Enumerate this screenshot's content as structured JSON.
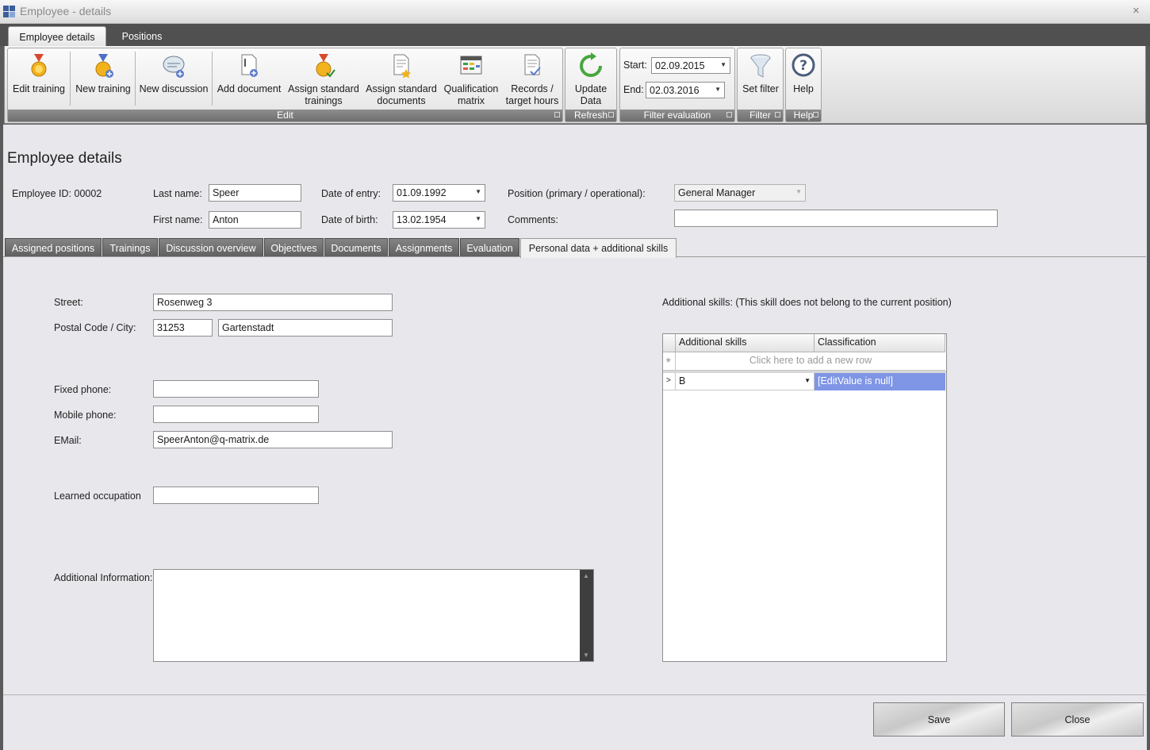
{
  "window": {
    "title": "Employee - details",
    "close_glyph": "×"
  },
  "ribbon": {
    "tabs": [
      {
        "label": "Employee details"
      },
      {
        "label": "Positions"
      }
    ],
    "groups": {
      "edit": {
        "caption": "Edit",
        "buttons": {
          "edit_training": "Edit training",
          "new_training": "New training",
          "new_discussion": "New discussion",
          "add_document": "Add document",
          "assign_std_trainings_1": "Assign standard",
          "assign_std_trainings_2": "trainings",
          "assign_std_documents_1": "Assign standard",
          "assign_std_documents_2": "documents",
          "qual_matrix_1": "Qualification",
          "qual_matrix_2": "matrix",
          "records_1": "Records /",
          "records_2": "target hours"
        }
      },
      "refresh": {
        "caption": "Refresh",
        "update_1": "Update",
        "update_2": "Data"
      },
      "filter_eval": {
        "caption": "Filter evaluation",
        "start_label": "Start:",
        "start_value": "02.09.2015",
        "end_label": "End:",
        "end_value": "02.03.2016"
      },
      "filter": {
        "caption": "Filter",
        "set_filter": "Set filter"
      },
      "help": {
        "caption": "Help",
        "help_button": "Help"
      }
    }
  },
  "page": {
    "title": "Employee details",
    "employee_id": "Employee ID: 00002",
    "last_name_label": "Last name:",
    "last_name": "Speer",
    "first_name_label": "First name:",
    "first_name": "Anton",
    "date_entry_label": "Date of entry:",
    "date_entry": "01.09.1992",
    "date_birth_label": "Date of birth:",
    "date_birth": "13.02.1954",
    "position_label": "Position (primary / operational):",
    "position": "General Manager",
    "comments_label": "Comments:",
    "comments": ""
  },
  "tabs": [
    {
      "label": "Assigned positions"
    },
    {
      "label": "Trainings"
    },
    {
      "label": "Discussion overview"
    },
    {
      "label": "Objectives"
    },
    {
      "label": "Documents"
    },
    {
      "label": "Assignments"
    },
    {
      "label": "Evaluation"
    },
    {
      "label": "Personal data + additional skills"
    }
  ],
  "personal": {
    "street_label": "Street:",
    "street": "Rosenweg 3",
    "postal_label": "Postal Code / City:",
    "postal_code": "31253",
    "city": "Gartenstadt",
    "fixed_phone_label": "Fixed phone:",
    "fixed_phone": "",
    "mobile_phone_label": "Mobile phone:",
    "mobile_phone": "",
    "email_label": "EMail:",
    "email": "SpeerAnton@q-matrix.de",
    "occupation_label": "Learned occupation",
    "occupation": "",
    "additional_info_label": "Additional Information:",
    "additional_info": ""
  },
  "skills": {
    "caption": "Additional skills: (This skill does not belong to the current position)",
    "columns": [
      "Additional skills",
      "Classification"
    ],
    "new_row_hint": "Click here to add a new row",
    "rows": [
      {
        "skill": "B",
        "classification": "[EditValue is null]"
      }
    ]
  },
  "footer": {
    "save": "Save",
    "close": "Close"
  },
  "colors": {
    "selection": "#7f95e6",
    "dark": "#505050"
  }
}
